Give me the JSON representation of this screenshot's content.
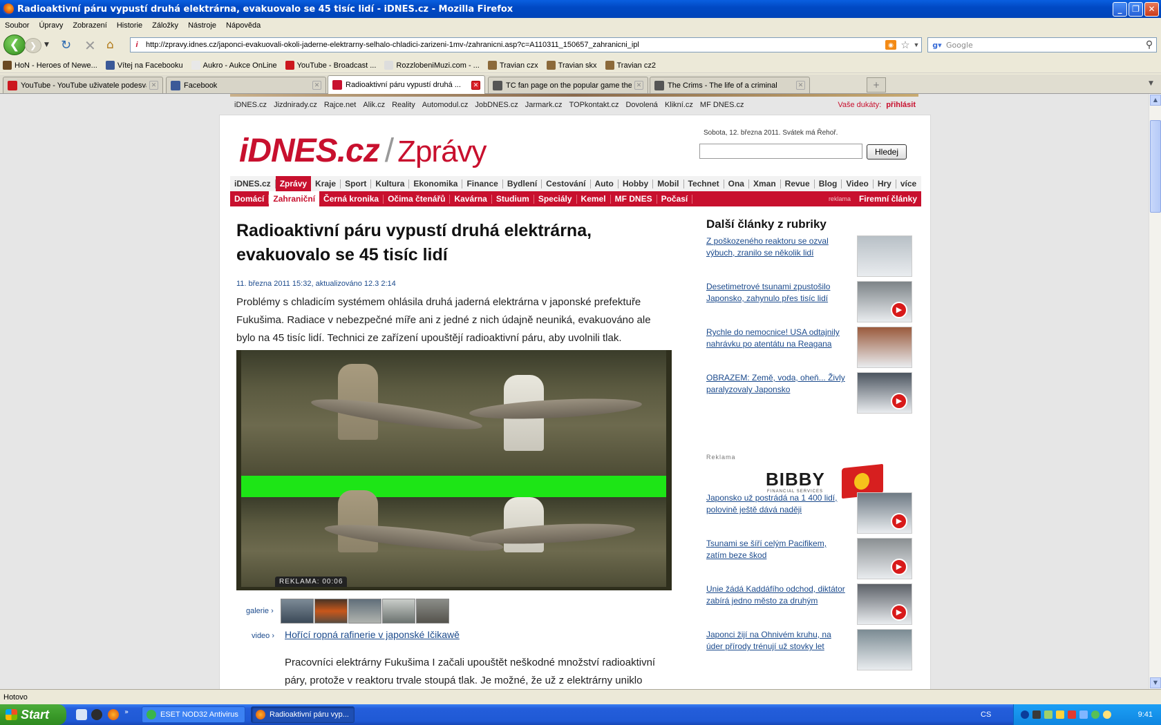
{
  "window": {
    "title": "Radioaktivní páru vypustí druhá elektrárna, evakuovalo se 45 tisíc lidí - iDNES.cz - Mozilla Firefox"
  },
  "menu": [
    "Soubor",
    "Úpravy",
    "Zobrazení",
    "Historie",
    "Záložky",
    "Nástroje",
    "Nápověda"
  ],
  "navbar": {
    "url": "http://zpravy.idnes.cz/japonci-evakuovali-okoli-jaderne-elektrarny-selhalo-chladici-zarizeni-1mv-/zahranicni.asp?c=A110311_150657_zahranicni_ipl",
    "search_placeholder": "Google"
  },
  "bookmarks": [
    {
      "label": "HoN - Heroes of Newe...",
      "icon": "hon-icon",
      "color": "#6b4a22"
    },
    {
      "label": "Vítej na Facebooku",
      "icon": "facebook-icon",
      "color": "#3b5998"
    },
    {
      "label": "Aukro - Aukce OnLine",
      "icon": "aukro-icon",
      "color": "#e8e8e8"
    },
    {
      "label": "YouTube - Broadcast ...",
      "icon": "youtube-icon",
      "color": "#cc181e"
    },
    {
      "label": "RozzlobeniMuzi.com - ...",
      "icon": "rozzlobeni-icon",
      "color": "#dddddd"
    },
    {
      "label": "Travian czx",
      "icon": "travian-icon",
      "color": "#8c6a3a"
    },
    {
      "label": "Travian skx",
      "icon": "travian-icon",
      "color": "#8c6a3a"
    },
    {
      "label": "Travian cz2",
      "icon": "travian-icon",
      "color": "#8c6a3a"
    }
  ],
  "tabs": [
    {
      "label": "YouTube - YouTube uživatele podesvat...",
      "color": "#cc181e"
    },
    {
      "label": "Facebook",
      "color": "#3b5998"
    },
    {
      "label": "Radioaktivní páru vypustí druhá ...",
      "color": "#c8102e"
    },
    {
      "label": "TC fan page on the popular game thecr...",
      "color": "#555555"
    },
    {
      "label": "The Crims - The life of a criminal",
      "color": "#555555"
    }
  ],
  "page": {
    "toplinks": [
      "iDNES.cz",
      "Jizdnirady.cz",
      "Rajce.net",
      "Alik.cz",
      "Reality",
      "Automodul.cz",
      "JobDNES.cz",
      "Jarmark.cz",
      "TOPkontakt.cz",
      "Dovolená",
      "Klikní.cz",
      "MF DNES.cz"
    ],
    "dukaty_label": "Vaše dukáty:",
    "dukaty_login": "přihlásit",
    "logo": "iDNES.cz",
    "logo_section": "Zprávy",
    "date": "Sobota, 12. března 2011. Svátek má Řehoř.",
    "search_button": "Hledej",
    "nav1": [
      "iDNES.cz",
      "Zprávy",
      "Kraje",
      "Sport",
      "Kultura",
      "Ekonomika",
      "Finance",
      "Bydlení",
      "Cestování",
      "Auto",
      "Hobby",
      "Mobil",
      "Technet",
      "Ona",
      "Xman",
      "Revue",
      "Blog",
      "Video",
      "Hry",
      "více"
    ],
    "nav2": [
      "Domácí",
      "Zahraniční",
      "Černá kronika",
      "Očima čtenářů",
      "Kavárna",
      "Studium",
      "Speciály",
      "Kemel",
      "MF DNES",
      "Počasí"
    ],
    "nav2_reklama": "reklama",
    "nav2_firemni": "Firemní články",
    "headline": "Radioaktivní páru vypustí druhá elektrárna, evakuovalo se 45 tisíc lidí",
    "dateline": "11. března 2011  15:32,  aktualizováno  12.3 2:14",
    "perex": "Problémy s chladicím systémem ohlásila druhá jaderná elektrárna v japonské prefektuře Fukušima. Radiace v nebezpečné míře ani z jedné z nich údajně neuniká, evakuováno ale bylo na 45 tisíc lidí. Technici ze zařízení upouštějí radioaktivní páru, aby uvolnili tlak.",
    "video_ad": "REKLAMA: 00:06",
    "gallery_label": "galerie",
    "video_label": "video",
    "video_link": "Hořící ropná rafinerie v japonské Ičikawě",
    "body": "Pracovníci elektrárny Fukušima I začali upouštět neškodné množství radioaktivní páry, protože v reaktoru trvale stoupá tlak. Je možné, že už z elektrárny uniklo",
    "sidebar_title": "Další články z rubriky",
    "sidebar_items": [
      {
        "text": "Z poškozeného reaktoru se ozval výbuch, zranilo se několik lidí",
        "video": false,
        "color": "#b8c0c6"
      },
      {
        "text": "Desetimetrové tsunami zpustošilo Japonsko, zahynulo přes tisíc lidí",
        "video": true,
        "color": "#7d8488"
      },
      {
        "text": "Rychle do nemocnice! USA odtajnily nahrávku po atentátu na Reagana",
        "video": false,
        "color": "#9a5a3c"
      },
      {
        "text": "OBRAZEM: Země, voda, oheň... Živly paralyzovaly Japonsko",
        "video": true,
        "color": "#4c5560"
      },
      {
        "text": "Japonsko už postrádá na 1 400 lidí, polovině ještě dává naději",
        "video": true,
        "color": "#6e7a84"
      },
      {
        "text": "Tsunami se šíří celým Pacifikem, zatím beze škod",
        "video": true,
        "color": "#8a8f92"
      },
      {
        "text": "Unie žádá Kaddáfího odchod, diktátor zabírá jedno město za druhým",
        "video": true,
        "color": "#5c6168"
      },
      {
        "text": "Japonci žijí na Ohnivém kruhu, na úder přírody trénují už stovky let",
        "video": false,
        "color": "#7b8b93"
      }
    ],
    "reklama_label": "Reklama",
    "ad_brand": "BIBBY",
    "ad_sub": "FINANCIAL SERVICES"
  },
  "status": "Hotovo",
  "taskbar": {
    "start": "Start",
    "tasks": [
      "ESET NOD32 Antivirus",
      "Radioaktivní páru vyp..."
    ],
    "lang": "CS",
    "clock": "9:41"
  }
}
